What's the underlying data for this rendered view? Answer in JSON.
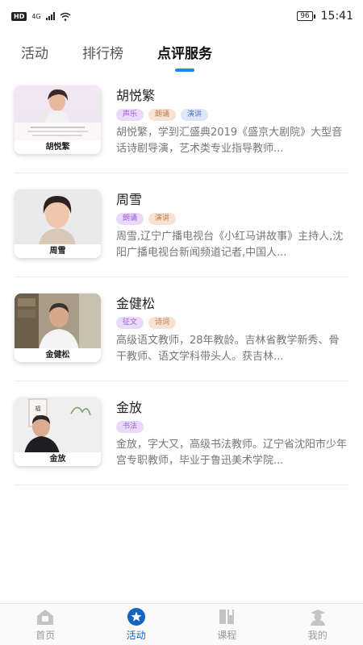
{
  "status_bar": {
    "hd": "HD",
    "signal": "4G",
    "battery": "96",
    "time": "15:41"
  },
  "tabs": [
    {
      "label": "活动",
      "active": false
    },
    {
      "label": "排行榜",
      "active": false
    },
    {
      "label": "点评服务",
      "active": true
    }
  ],
  "teachers": [
    {
      "name": "胡悦繁",
      "caption": "胡悦繁",
      "tags": [
        {
          "label": "声乐",
          "color": "#9c5ed6",
          "bg": "#ead9f8"
        },
        {
          "label": "朗诵",
          "color": "#c2784a",
          "bg": "#f6e3d6"
        },
        {
          "label": "演讲",
          "color": "#4a78c2",
          "bg": "#dde7f8"
        }
      ],
      "desc": "胡悦繁，学到汇盛典2019《盛京大剧院》大型音话诗剧导演，艺术类专业指导教师..."
    },
    {
      "name": "周雪",
      "caption": "周雪",
      "tags": [
        {
          "label": "朗诵",
          "color": "#9c5ed6",
          "bg": "#ead9f8"
        },
        {
          "label": "演讲",
          "color": "#c2784a",
          "bg": "#f6e3d6"
        }
      ],
      "desc": "周雪,辽宁广播电视台《小红马讲故事》主持人,沈阳广播电视台新闻频道记者,中国人..."
    },
    {
      "name": "金健松",
      "caption": "金健松",
      "tags": [
        {
          "label": "征文",
          "color": "#9c5ed6",
          "bg": "#ead9f8"
        },
        {
          "label": "诗词",
          "color": "#c2784a",
          "bg": "#f6e3d6"
        }
      ],
      "desc": "高级语文教师，28年教龄。吉林省教学新秀、骨干教师、语文学科带头人。获吉林..."
    },
    {
      "name": "金放",
      "caption": "金放",
      "tags": [
        {
          "label": "书法",
          "color": "#9c5ed6",
          "bg": "#ead9f8"
        }
      ],
      "desc": "金放，字大又，高级书法教师。辽宁省沈阳市少年宫专职教师，毕业于鲁迅美术学院..."
    }
  ],
  "bottom_nav": [
    {
      "label": "首页",
      "icon": "home-icon",
      "active": false
    },
    {
      "label": "活动",
      "icon": "star-icon",
      "active": true
    },
    {
      "label": "课程",
      "icon": "book-icon",
      "active": false
    },
    {
      "label": "我的",
      "icon": "profile-icon",
      "active": false
    }
  ],
  "colors": {
    "accent": "#1e88e5",
    "active_nav": "#1565c0"
  }
}
